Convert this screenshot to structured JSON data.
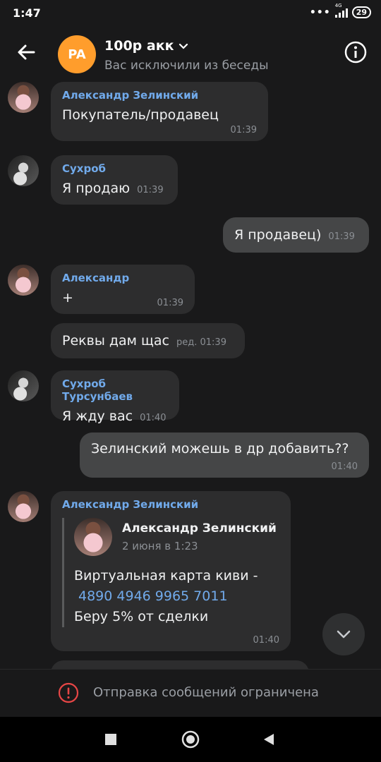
{
  "status": {
    "time": "1:47",
    "network": "4G",
    "battery": "29"
  },
  "header": {
    "avatar_initials": "PA",
    "title": "100р акк",
    "subtitle": "Вас исключили из беседы"
  },
  "messages": [
    {
      "author": "Александр Зелинский",
      "text": "Покупатель/продавец",
      "time": "01:39"
    },
    {
      "author": "Сухроб",
      "text": "Я продаю",
      "time": "01:39"
    },
    {
      "text": "Я продавец)",
      "time": "01:39",
      "outgoing": true
    },
    {
      "author": "Александр",
      "text": "+",
      "time": "01:39"
    },
    {
      "text": "Реквы дам щас",
      "time": "ред. 01:39"
    },
    {
      "author": "Сухроб Турсунбаев",
      "text": "Я жду вас",
      "time": "01:40"
    },
    {
      "text": "Зелинский можешь в др добавить??",
      "time": "01:40",
      "outgoing": true
    },
    {
      "author": "Александр Зелинский",
      "time": "01:40",
      "forwarded": {
        "author": "Александр Зелинский",
        "date": "2 июня в 1:23",
        "line1": "Виртуальная карта киви -",
        "card": "4890 4946 9965 7011",
        "line3": "Беру 5% от сделки"
      }
    }
  ],
  "footer": {
    "restricted_text": "Отправка сообщений ограничена"
  },
  "icons": {
    "back": "arrow-left-icon",
    "info": "info-icon",
    "chevron": "chevron-down-icon",
    "scroll": "chevron-down-icon",
    "warning": "warning-icon",
    "nav": [
      "square-icon",
      "circle-icon",
      "triangle-icon"
    ]
  },
  "colors": {
    "accent": "#71aaeb",
    "avatar_bg": "#ff9d2c",
    "warning": "#e64646"
  }
}
